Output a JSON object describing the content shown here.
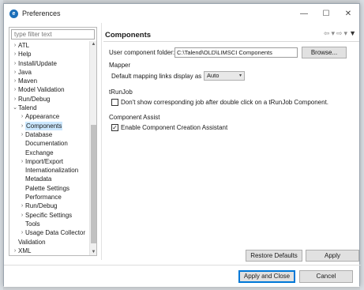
{
  "window": {
    "title": "Preferences",
    "minimize_glyph": "—",
    "maximize_glyph": "☐",
    "close_glyph": "✕"
  },
  "filter": {
    "placeholder": "type filter text"
  },
  "tree": [
    {
      "label": "ATL",
      "level": 0,
      "arrow": ">"
    },
    {
      "label": "Help",
      "level": 0,
      "arrow": ">"
    },
    {
      "label": "Install/Update",
      "level": 0,
      "arrow": ">"
    },
    {
      "label": "Java",
      "level": 0,
      "arrow": ">"
    },
    {
      "label": "Maven",
      "level": 0,
      "arrow": ">"
    },
    {
      "label": "Model Validation",
      "level": 0,
      "arrow": ">"
    },
    {
      "label": "Run/Debug",
      "level": 0,
      "arrow": ">"
    },
    {
      "label": "Talend",
      "level": 0,
      "arrow": "v"
    },
    {
      "label": "Appearance",
      "level": 1,
      "arrow": ">"
    },
    {
      "label": "Components",
      "level": 1,
      "arrow": ">",
      "selected": true
    },
    {
      "label": "Database",
      "level": 1,
      "arrow": ">"
    },
    {
      "label": "Documentation",
      "level": 1,
      "arrow": ""
    },
    {
      "label": "Exchange",
      "level": 1,
      "arrow": ""
    },
    {
      "label": "Import/Export",
      "level": 1,
      "arrow": ">"
    },
    {
      "label": "Internationalization",
      "level": 1,
      "arrow": ""
    },
    {
      "label": "Metadata",
      "level": 1,
      "arrow": ""
    },
    {
      "label": "Palette Settings",
      "level": 1,
      "arrow": ""
    },
    {
      "label": "Performance",
      "level": 1,
      "arrow": ""
    },
    {
      "label": "Run/Debug",
      "level": 1,
      "arrow": ">"
    },
    {
      "label": "Specific Settings",
      "level": 1,
      "arrow": ">"
    },
    {
      "label": "Tools",
      "level": 1,
      "arrow": ""
    },
    {
      "label": "Usage Data Collector",
      "level": 1,
      "arrow": ">"
    },
    {
      "label": "Validation",
      "level": 0,
      "arrow": ""
    },
    {
      "label": "XML",
      "level": 0,
      "arrow": ">"
    }
  ],
  "page": {
    "title": "Components",
    "nav_back": "⇦",
    "nav_down1": "▾",
    "nav_forward": "⇨",
    "nav_down2": "▾",
    "nav_menu": "▼",
    "folder_label": "User component folder:",
    "folder_value": "C:\\Talend\\OLD\\LIMSCI Components",
    "browse_label": "Browse...",
    "mapper_header": "Mapper",
    "mapping_label": "Default mapping links display as :",
    "mapping_value": "Auto",
    "trunjob_header": "tRunJob",
    "trunjob_check_label": "Don't show corresponding job after double click on a tRunJob Component.",
    "trunjob_checked": false,
    "assist_header": "Component Assist",
    "assist_check_label": "Enable Component Creation Assistant",
    "assist_checked": true,
    "restore_label": "Restore Defaults",
    "apply_label": "Apply"
  },
  "footer": {
    "apply_close_label": "Apply and Close",
    "cancel_label": "Cancel"
  }
}
